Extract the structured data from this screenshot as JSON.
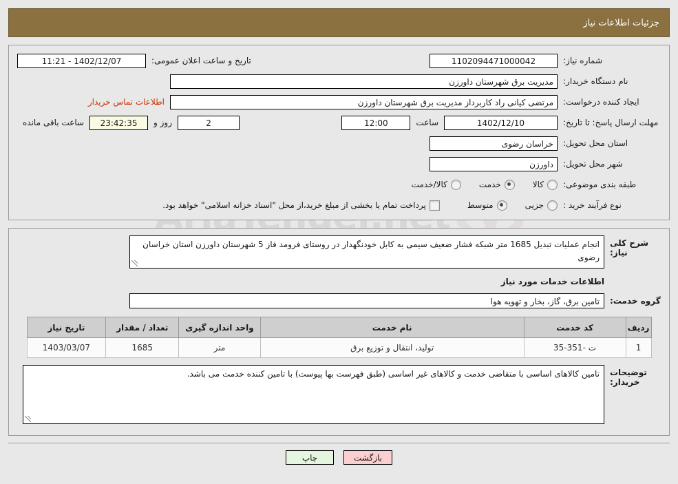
{
  "header": {
    "title": "جزئیات اطلاعات نیاز"
  },
  "form": {
    "need_number_label": "شماره نیاز:",
    "need_number_value": "1102094471000042",
    "announce_label": "تاریخ و ساعت اعلان عمومی:",
    "announce_value": "1402/12/07 - 11:21",
    "buyer_org_label": "نام دستگاه خریدار:",
    "buyer_org_value": "مدیریت برق شهرستان داورزن",
    "creator_label": "ایجاد کننده درخواست:",
    "creator_value": "مرتضی کیانی راد کاربرداز مدیریت برق شهرستان داورزن",
    "contact_link": "اطلاعات تماس خریدار",
    "deadline_label": "مهلت ارسال پاسخ: تا تاریخ:",
    "deadline_date": "1402/12/10",
    "hour_label": "ساعت",
    "hour_value": "12:00",
    "days_value": "2",
    "days_label": "روز و",
    "countdown_value": "23:42:35",
    "countdown_label": "ساعت باقی مانده",
    "province_label": "استان محل تحویل:",
    "province_value": "خراسان رضوی",
    "city_label": "شهر محل تحویل:",
    "city_value": "داورزن",
    "category_label": "طبقه بندی موضوعی:",
    "category_options": [
      {
        "label": "کالا",
        "selected": false
      },
      {
        "label": "خدمت",
        "selected": true
      },
      {
        "label": "کالا/خدمت",
        "selected": false
      }
    ],
    "process_label": "نوع فرآیند خرید :",
    "process_options": [
      {
        "label": "جزیی",
        "selected": false
      },
      {
        "label": "متوسط",
        "selected": true
      }
    ],
    "treasury_checkbox_label": "پرداخت تمام یا بخشی از مبلغ خرید،از محل \"اسناد خزانه اسلامی\" خواهد بود.",
    "treasury_checked": false
  },
  "details": {
    "summary_label": "شرح کلی نیاز:",
    "summary_value": "انجام عملیات تبدیل 1685 متر شبکه فشار ضعیف سیمی به کابل خودنگهدار در روستای فرومد فاز 5 شهرستان داورزن استان خراسان رضوی",
    "services_heading": "اطلاعات خدمات مورد نیاز",
    "service_group_label": "گروه خدمت:",
    "service_group_value": "تامین برق، گاز، بخار و تهویه هوا",
    "notes_label": "توضیحات خریدار:",
    "notes_value": "تامین کالاهای اساسی با متقاضی خدمت و کالاهای غیر اساسی (طبق فهرست بها پیوست) با تامین کننده خدمت می باشد."
  },
  "table": {
    "columns": [
      "ردیف",
      "کد خدمت",
      "نام خدمت",
      "واحد اندازه گیری",
      "تعداد / مقدار",
      "تاریخ نیاز"
    ],
    "rows": [
      {
        "radif": "1",
        "code": "ت -351-35",
        "name": "تولید، انتقال و توزیع برق",
        "unit": "متر",
        "qty": "1685",
        "date": "1403/03/07"
      }
    ]
  },
  "footer": {
    "back_label": "بازگشت",
    "print_label": "چاپ"
  },
  "watermark": {
    "text": "AriaTender.net"
  }
}
